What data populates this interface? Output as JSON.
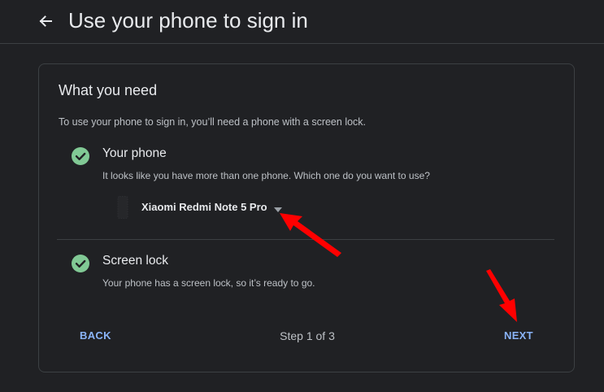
{
  "header": {
    "back_icon": "arrow-left-icon",
    "title": "Use your phone to sign in"
  },
  "card": {
    "title": "What you need",
    "intro": "To use your phone to sign in, you’ll need a phone with a screen lock."
  },
  "requirements": {
    "phone": {
      "icon": "check-circle-icon",
      "label": "Your phone",
      "description": "It looks like you have more than one phone. Which one do you want to use?",
      "selected_phone": "Xiaomi Redmi Note 5 Pro"
    },
    "screen_lock": {
      "icon": "check-circle-icon",
      "label": "Screen lock",
      "description": "Your phone has a screen lock, so it’s ready to go."
    }
  },
  "footer": {
    "back_label": "BACK",
    "step": "Step 1 of 3",
    "next_label": "NEXT"
  },
  "colors": {
    "background": "#202124",
    "accent": "#8ab4f8",
    "check": "#81c995",
    "annotation": "#ff0000"
  }
}
